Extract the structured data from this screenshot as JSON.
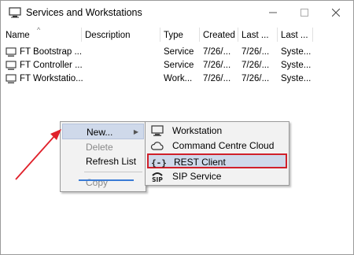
{
  "window": {
    "title": "Services and Workstations",
    "icon": "monitor-icon"
  },
  "columns": [
    "Name",
    "Description",
    "Type",
    "Created",
    "Last ...",
    "Last ..."
  ],
  "rows": [
    {
      "name": "FT Bootstrap ...",
      "description": "",
      "type": "Service",
      "created": "7/26/...",
      "last1": "7/26/...",
      "last2": "Syste..."
    },
    {
      "name": "FT Controller ...",
      "description": "",
      "type": "Service",
      "created": "7/26/...",
      "last1": "7/26/...",
      "last2": "Syste..."
    },
    {
      "name": "FT Workstatio...",
      "description": "",
      "type": "Work...",
      "created": "7/26/...",
      "last1": "7/26/...",
      "last2": "Syste..."
    }
  ],
  "context_menu": {
    "items": [
      {
        "label": "New...",
        "highlighted": true,
        "disabled": false,
        "has_submenu": true
      },
      {
        "label": "Delete",
        "highlighted": false,
        "disabled": true,
        "has_submenu": false
      },
      {
        "label": "Refresh List",
        "highlighted": false,
        "disabled": false,
        "has_submenu": false
      },
      {
        "label": "Copy",
        "highlighted": false,
        "disabled": true,
        "has_submenu": false
      }
    ]
  },
  "submenu": {
    "items": [
      {
        "label": "Workstation",
        "icon": "monitor-icon",
        "selected": false
      },
      {
        "label": "Command Centre Cloud",
        "icon": "cloud-icon",
        "selected": false
      },
      {
        "label": "REST Client",
        "icon": "rest-client-icon",
        "selected": true
      },
      {
        "label": "SIP Service",
        "icon": "sip-icon",
        "selected": false
      }
    ]
  },
  "colors": {
    "highlight": "#cfd9ea",
    "selection_outline": "#d0202a",
    "annotation_arrow": "#e0202a"
  }
}
